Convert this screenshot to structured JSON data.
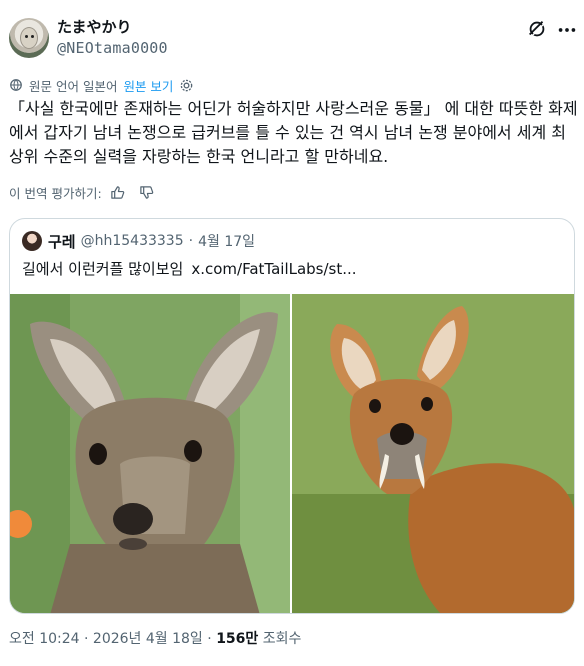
{
  "author": {
    "display_name": "たまやかり",
    "handle": "@NEOtama0000",
    "avatar_icon": "avatar"
  },
  "translation": {
    "source_label": "원문 언어 일본어",
    "show_original": "원본 보기"
  },
  "tweet": {
    "text": "「사실 한국에만 존재하는 어딘가 허술하지만 사랑스러운 동물」 에 대한 따뜻한 화제에서 갑자기 남녀 논쟁으로 급커브를 틀 수 있는 건 역시 남녀 논쟁 분야에서 세계 최상위 수준의 실력을 자랑하는 한국 언니라고 할 만하네요."
  },
  "rate_translation": {
    "label": "이 번역 평가하기:"
  },
  "quote": {
    "name": "구레",
    "handle": "@hh15433335",
    "date": "4월 17일",
    "text": "길에서 이런커플 많이보임",
    "link": "x.com/FatTailLabs/st..."
  },
  "meta": {
    "time": "오전 10:24",
    "date": "2026년 4월 18일",
    "separator": "·",
    "views_count": "156만",
    "views_label": "조회수"
  },
  "colors": {
    "text": "#0f1419",
    "secondary": "#536471",
    "link": "#1d9bf0",
    "border": "#cfd9de"
  }
}
